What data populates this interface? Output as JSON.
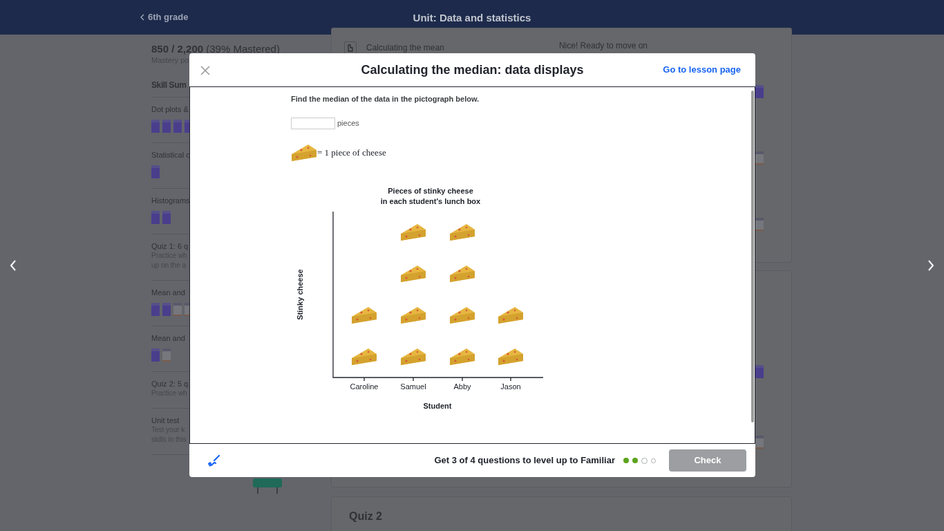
{
  "header": {
    "back_link": "6th grade",
    "title": "Unit: Data and statistics"
  },
  "sidebar": {
    "points": "850 / 2,200",
    "mastered": "(39% Mastered)",
    "points_label": "Mastery po",
    "heading": "Skill Sum",
    "items": [
      {
        "title": "Dot plots &",
        "squares": [
          {
            "mastered": true
          },
          {
            "mastered": true
          },
          {
            "mastered": true
          },
          {
            "mastered": true
          }
        ]
      },
      {
        "title": "Statistical c",
        "squares": [
          {
            "mastered": true
          }
        ]
      },
      {
        "title": "Histograms",
        "squares": [
          {
            "mastered": true
          },
          {
            "mastered": true
          }
        ]
      },
      {
        "title": "Quiz 1: 6 q",
        "description_lines": [
          "Practice wh",
          "up on the a"
        ]
      },
      {
        "title": "Mean and",
        "squares": [
          {
            "mastered": true
          },
          {
            "mastered": true
          },
          {
            "mastered": false
          },
          {
            "mastered": false
          }
        ]
      },
      {
        "title": "Mean and",
        "squares": [
          {
            "mastered": true
          },
          {
            "mastered": false
          }
        ]
      },
      {
        "title": "Quiz 2: 5 q",
        "description_lines": [
          "Practice wh"
        ]
      },
      {
        "title": "Unit test",
        "description_lines": [
          "Test your k",
          "skills in this"
        ]
      }
    ]
  },
  "main": {
    "lesson_row": {
      "title": "Calculating the mean",
      "status": "Nice! Ready to move on"
    },
    "side_marks": [
      {
        "mastered": true
      },
      {
        "mastered": false
      },
      {
        "mastered": false
      },
      {
        "mastered": true
      },
      {
        "mastered": false
      }
    ],
    "quiz_title": "Quiz 2"
  },
  "modal": {
    "title": "Calculating the median: data displays",
    "link": "Go to lesson page",
    "question": "Find the median of the data in the pictograph below.",
    "answer_unit": "pieces",
    "legend": "= 1 piece of cheese",
    "pictograph": {
      "title": "Pieces of stinky cheese\nin each student's lunch box",
      "xlabel": "Student",
      "ylabel": "Stinky cheese",
      "columns": [
        {
          "label": "Caroline",
          "icons": [
            {
              "kind": "cheese"
            },
            {
              "kind": "cheese"
            }
          ]
        },
        {
          "label": "Samuel",
          "icons": [
            {
              "kind": "cheese"
            },
            {
              "kind": "cheese"
            },
            {
              "kind": "cheese"
            },
            {
              "kind": "cheese"
            }
          ]
        },
        {
          "label": "Abby",
          "icons": [
            {
              "kind": "cheese"
            },
            {
              "kind": "cheese"
            },
            {
              "kind": "cheese"
            },
            {
              "kind": "cheese"
            }
          ]
        },
        {
          "label": "Jason",
          "icons": [
            {
              "kind": "cheese"
            },
            {
              "kind": "cheese"
            }
          ]
        }
      ]
    },
    "footer": {
      "message": "Get 3 of 4 questions to level up to Familiar",
      "dots": [
        {
          "kind": "done"
        },
        {
          "kind": "done"
        },
        {
          "kind": "current"
        },
        {
          "kind": "pending"
        }
      ],
      "check_button": {
        "label": "Check",
        "disabled": true
      }
    }
  }
}
